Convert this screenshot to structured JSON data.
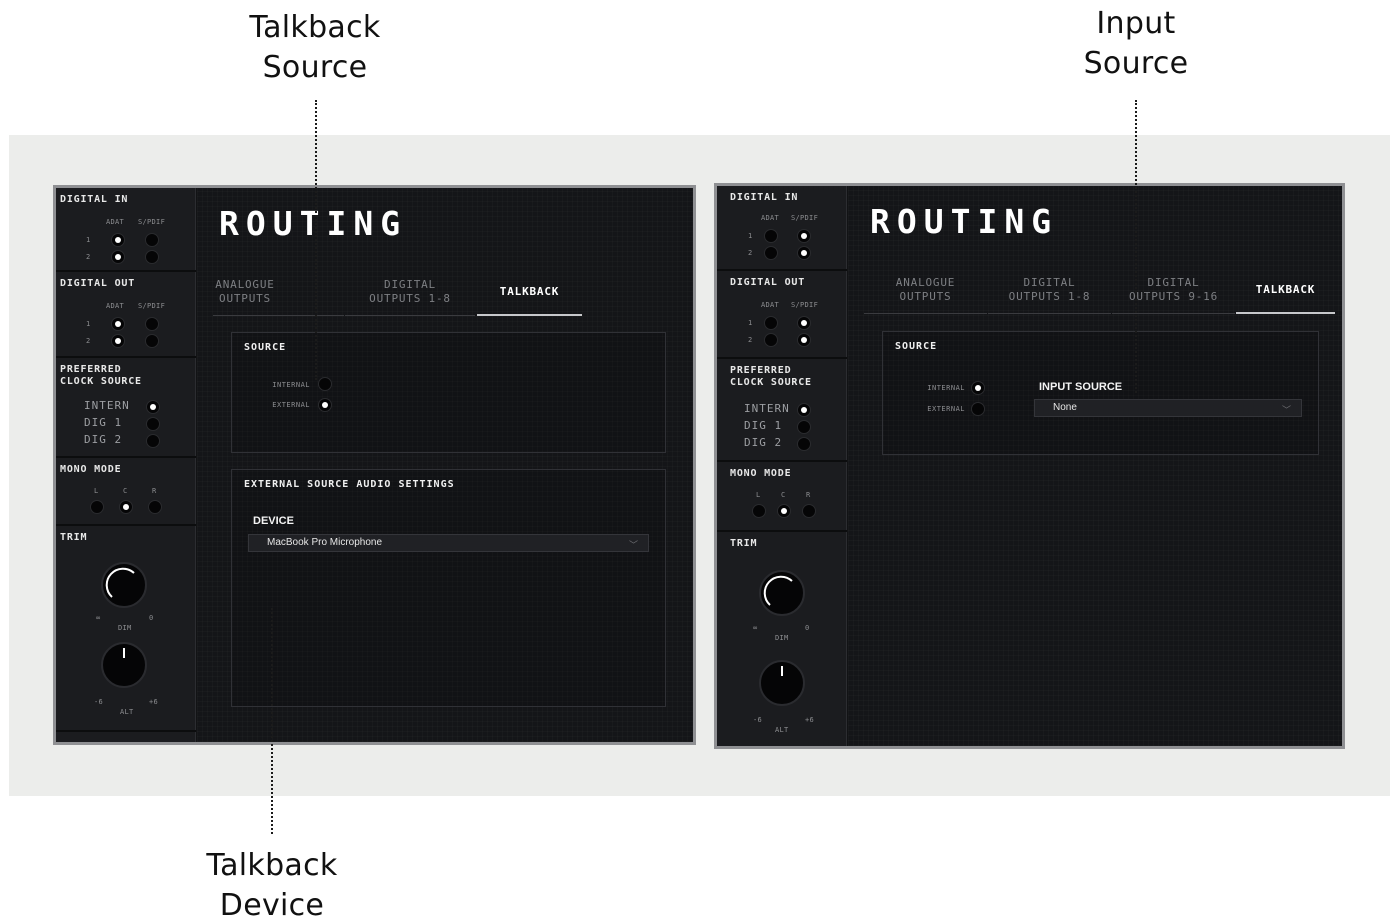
{
  "annotations": {
    "talkback_source": [
      "Talkback",
      "Source"
    ],
    "input_source": [
      "Input",
      "Source"
    ],
    "talkback_device": [
      "Talkback",
      "Device"
    ]
  },
  "left_panel": {
    "sidebar": {
      "digital_in": {
        "title": "DIGITAL IN",
        "col1": "ADAT",
        "col2": "S/PDIF",
        "rows": [
          "1",
          "2"
        ],
        "selected": [
          "ADAT",
          "ADAT"
        ]
      },
      "digital_out": {
        "title": "DIGITAL OUT",
        "col1": "ADAT",
        "col2": "S/PDIF",
        "rows": [
          "1",
          "2"
        ],
        "selected": [
          "ADAT",
          "ADAT"
        ]
      },
      "clock": {
        "title_line1": "PREFERRED",
        "title_line2": "CLOCK SOURCE",
        "options": [
          "INTERN",
          "DIG 1",
          "DIG 2"
        ],
        "selected": "INTERN"
      },
      "mono": {
        "title": "MONO MODE",
        "options": [
          "L",
          "C",
          "R"
        ],
        "selected": "C"
      },
      "trim": {
        "title": "TRIM",
        "dim_min": "∞",
        "dim_label": "DIM",
        "dim_max": "0",
        "alt_min": "-6",
        "alt_label": "ALT",
        "alt_max": "+6"
      }
    },
    "title": "ROUTING",
    "tabs": [
      {
        "line1": "ANALOGUE",
        "line2": "OUTPUTS"
      },
      {
        "line1": "DIGITAL",
        "line2": "OUTPUTS 1-8"
      },
      {
        "line1": "TALKBACK",
        "line2": ""
      }
    ],
    "active_tab": "TALKBACK",
    "source_box": {
      "title": "SOURCE",
      "internal": "INTERNAL",
      "external": "EXTERNAL",
      "selected": "EXTERNAL"
    },
    "external_box": {
      "title": "EXTERNAL SOURCE AUDIO SETTINGS",
      "device_label": "DEVICE",
      "device_value": "MacBook Pro Microphone"
    }
  },
  "right_panel": {
    "sidebar": {
      "digital_in": {
        "title": "DIGITAL IN",
        "col1": "ADAT",
        "col2": "S/PDIF",
        "rows": [
          "1",
          "2"
        ],
        "selected": [
          "S/PDIF",
          "S/PDIF"
        ]
      },
      "digital_out": {
        "title": "DIGITAL OUT",
        "col1": "ADAT",
        "col2": "S/PDIF",
        "rows": [
          "1",
          "2"
        ],
        "selected": [
          "S/PDIF",
          "S/PDIF"
        ]
      },
      "clock": {
        "title_line1": "PREFERRED",
        "title_line2": "CLOCK SOURCE",
        "options": [
          "INTERN",
          "DIG 1",
          "DIG 2"
        ],
        "selected": "INTERN"
      },
      "mono": {
        "title": "MONO MODE",
        "options": [
          "L",
          "C",
          "R"
        ],
        "selected": "C"
      },
      "trim": {
        "title": "TRIM",
        "dim_min": "∞",
        "dim_label": "DIM",
        "dim_max": "0",
        "alt_min": "-6",
        "alt_label": "ALT",
        "alt_max": "+6"
      }
    },
    "title": "ROUTING",
    "tabs": [
      {
        "line1": "ANALOGUE",
        "line2": "OUTPUTS"
      },
      {
        "line1": "DIGITAL",
        "line2": "OUTPUTS 1-8"
      },
      {
        "line1": "DIGITAL",
        "line2": "OUTPUTS 9-16"
      },
      {
        "line1": "TALKBACK",
        "line2": ""
      }
    ],
    "active_tab": "TALKBACK",
    "source_box": {
      "title": "SOURCE",
      "internal": "INTERNAL",
      "external": "EXTERNAL",
      "selected": "INTERNAL",
      "input_source_label": "INPUT SOURCE",
      "input_source_value": "None"
    }
  },
  "colors": {
    "band": "#ecedeb",
    "panel_border": "#8f9093",
    "panel_bg": "#121315",
    "led_on": "#ffffff"
  }
}
